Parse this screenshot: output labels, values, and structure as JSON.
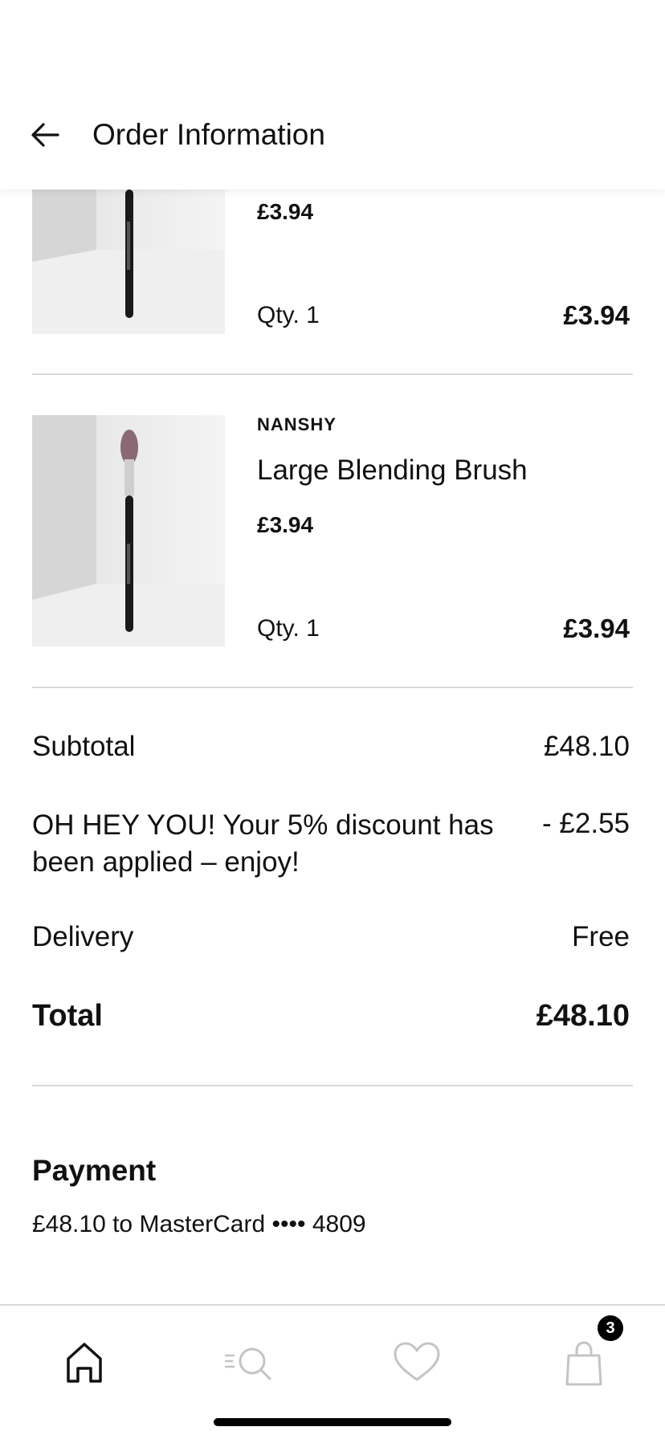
{
  "header": {
    "title": "Order Information",
    "back_icon": "arrow-left-icon"
  },
  "items": [
    {
      "unit_price": "£3.94",
      "qty": "Qty. 1",
      "line_price": "£3.94"
    },
    {
      "brand": "NANSHY",
      "name": "Large Blending Brush",
      "unit_price": "£3.94",
      "qty": "Qty. 1",
      "line_price": "£3.94"
    }
  ],
  "summary": {
    "subtotal_label": "Subtotal",
    "subtotal_value": "£48.10",
    "discount_label": "OH HEY YOU! Your 5% discount has been applied – enjoy!",
    "discount_value": "- £2.55",
    "delivery_label": "Delivery",
    "delivery_value": "Free",
    "total_label": "Total",
    "total_value": "£48.10"
  },
  "payment": {
    "title": "Payment",
    "text": "£48.10 to MasterCard •••• 4809"
  },
  "bottom_nav": {
    "items": [
      "home-icon",
      "search-icon",
      "heart-icon",
      "shopping-bag-icon"
    ],
    "cart_count": "3"
  },
  "colors": {
    "text": "#111111",
    "divider": "#d9d9d9",
    "inactive_icon": "#c4c4c4",
    "badge": "#000000"
  }
}
